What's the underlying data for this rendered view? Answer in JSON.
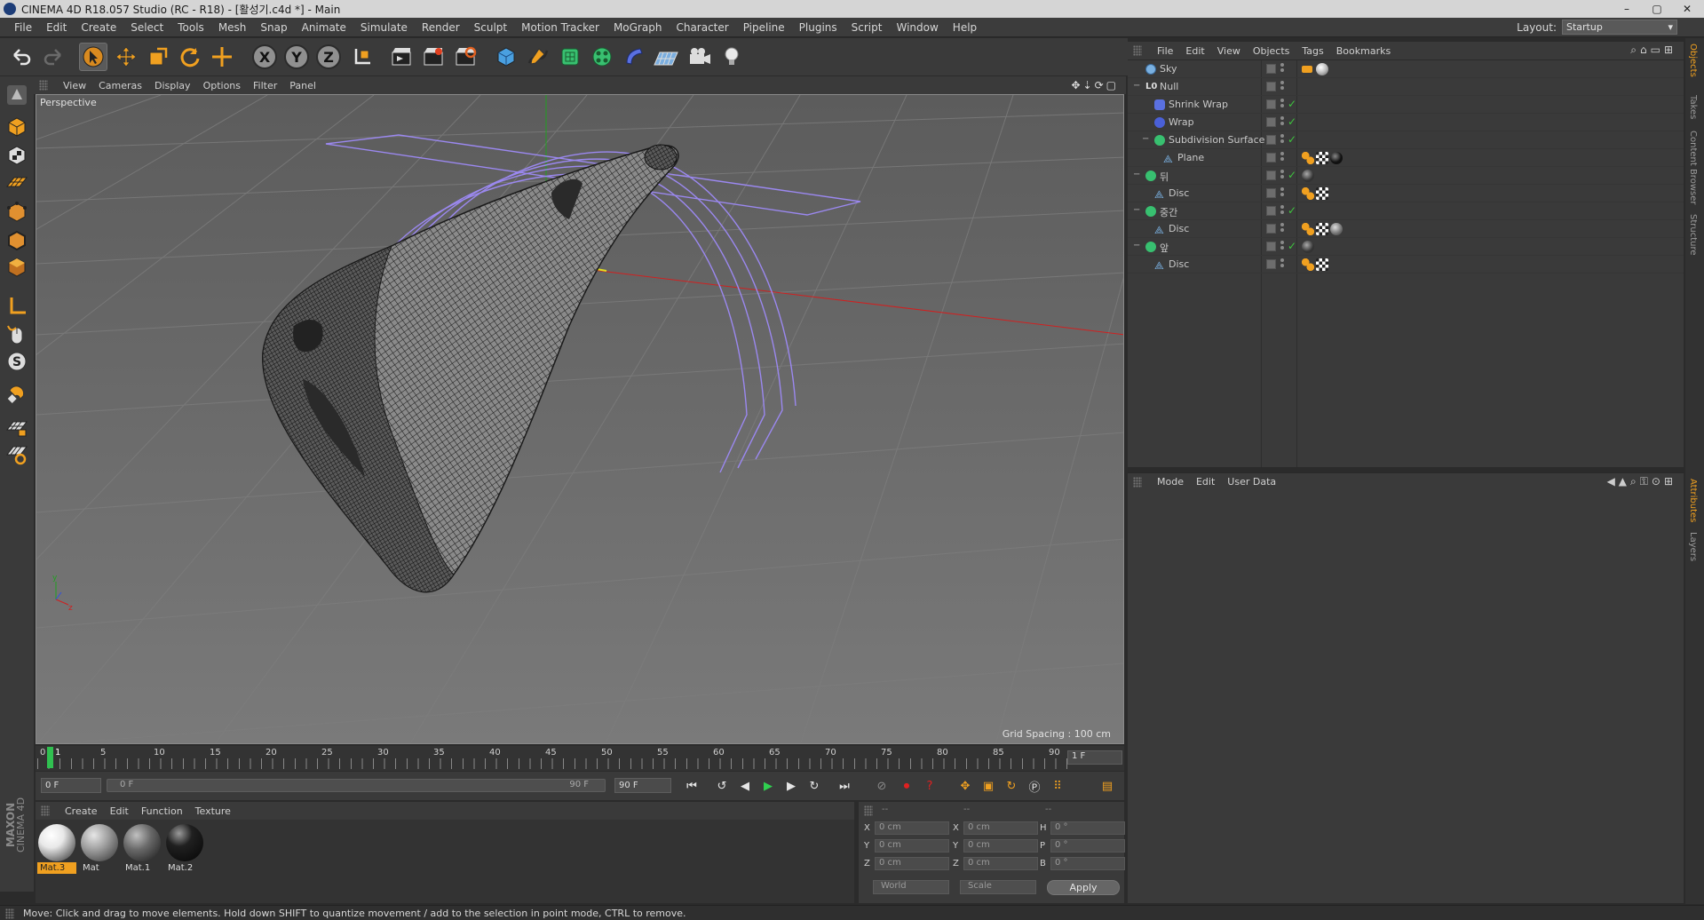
{
  "window": {
    "title": "CINEMA 4D R18.057 Studio (RC - R18) - [활성기.c4d *] - Main",
    "controls": [
      "–",
      "▢",
      "✕"
    ]
  },
  "menubar": {
    "items": [
      "File",
      "Edit",
      "Create",
      "Select",
      "Tools",
      "Mesh",
      "Snap",
      "Animate",
      "Simulate",
      "Render",
      "Sculpt",
      "Motion Tracker",
      "MoGraph",
      "Character",
      "Pipeline",
      "Plugins",
      "Script",
      "Window",
      "Help"
    ],
    "layout_label": "Layout:",
    "layout_value": "Startup"
  },
  "toolbar": {
    "axis_x": "X",
    "axis_y": "Y",
    "axis_z": "Z"
  },
  "viewport": {
    "menu": [
      "View",
      "Cameras",
      "Display",
      "Options",
      "Filter",
      "Panel"
    ],
    "camera_label": "Perspective",
    "grid_spacing": "Grid Spacing : 100 cm",
    "axis_y": "y",
    "axis_z": "z"
  },
  "timeline": {
    "ticks": [
      "0",
      "5",
      "10",
      "15",
      "20",
      "25",
      "30",
      "35",
      "40",
      "45",
      "50",
      "55",
      "60",
      "65",
      "70",
      "75",
      "80",
      "85",
      "90"
    ],
    "current_marker": "1",
    "current_frame": "1 F"
  },
  "transport": {
    "start_field": "0 F",
    "range_start": "0 F",
    "range_end": "90 F",
    "end_field": "90 F"
  },
  "materials": {
    "menu": [
      "Create",
      "Edit",
      "Function",
      "Texture"
    ],
    "items": [
      {
        "name": "Mat.3",
        "selected": true
      },
      {
        "name": "Mat",
        "selected": false
      },
      {
        "name": "Mat.1",
        "selected": false
      },
      {
        "name": "Mat.2",
        "selected": false
      }
    ]
  },
  "coordinates": {
    "headers": [
      "--",
      "--",
      "--"
    ],
    "rows": [
      {
        "l1": "X",
        "v1": "0 cm",
        "l2": "X",
        "v2": "0 cm",
        "l3": "H",
        "v3": "0 °"
      },
      {
        "l1": "Y",
        "v1": "0 cm",
        "l2": "Y",
        "v2": "0 cm",
        "l3": "P",
        "v3": "0 °"
      },
      {
        "l1": "Z",
        "v1": "0 cm",
        "l2": "Z",
        "v2": "0 cm",
        "l3": "B",
        "v3": "0 °"
      }
    ],
    "space": "World",
    "mode": "Scale",
    "apply": "Apply"
  },
  "object_manager": {
    "menu": [
      "File",
      "Edit",
      "View",
      "Objects",
      "Tags",
      "Bookmarks"
    ],
    "objects": [
      {
        "name": "Sky",
        "indent": 0,
        "expand": "",
        "color": "#dfe6ef"
      },
      {
        "name": "Null",
        "indent": 0,
        "expand": "−",
        "color": "#dfe6ef"
      },
      {
        "name": "Shrink Wrap",
        "indent": 1,
        "expand": "",
        "color": "#dfe6ef"
      },
      {
        "name": "Wrap",
        "indent": 1,
        "expand": "",
        "color": "#dfe6ef"
      },
      {
        "name": "Subdivision Surface",
        "indent": 1,
        "expand": "−",
        "color": "#dfe6ef"
      },
      {
        "name": "Plane",
        "indent": 2,
        "expand": "",
        "color": "#dfe6ef"
      },
      {
        "name": "뒤",
        "indent": 0,
        "expand": "−",
        "color": "#dfe6ef"
      },
      {
        "name": "Disc",
        "indent": 1,
        "expand": "",
        "color": "#dfe6ef"
      },
      {
        "name": "중간",
        "indent": 0,
        "expand": "−",
        "color": "#dfe6ef"
      },
      {
        "name": "Disc",
        "indent": 1,
        "expand": "",
        "color": "#dfe6ef"
      },
      {
        "name": "앞",
        "indent": 0,
        "expand": "−",
        "color": "#dfe6ef"
      },
      {
        "name": "Disc",
        "indent": 1,
        "expand": "",
        "color": "#dfe6ef"
      }
    ]
  },
  "attribute_manager": {
    "menu": [
      "Mode",
      "Edit",
      "User Data"
    ]
  },
  "right_tabs": [
    "Objects",
    "Takes",
    "Content Browser",
    "Structure",
    "Attributes",
    "Layers"
  ],
  "status": {
    "text": "Move: Click and drag to move elements. Hold down SHIFT to quantize movement / add to the selection in point mode, CTRL to remove."
  },
  "branding": {
    "maxon": "MAXON",
    "product": "CINEMA 4D"
  },
  "colors": {
    "accent": "#f0a020",
    "spline": "#9b88f0",
    "x_axis": "#d02020",
    "y_axis": "#20a020",
    "enabled_check": "#3ec43e"
  }
}
